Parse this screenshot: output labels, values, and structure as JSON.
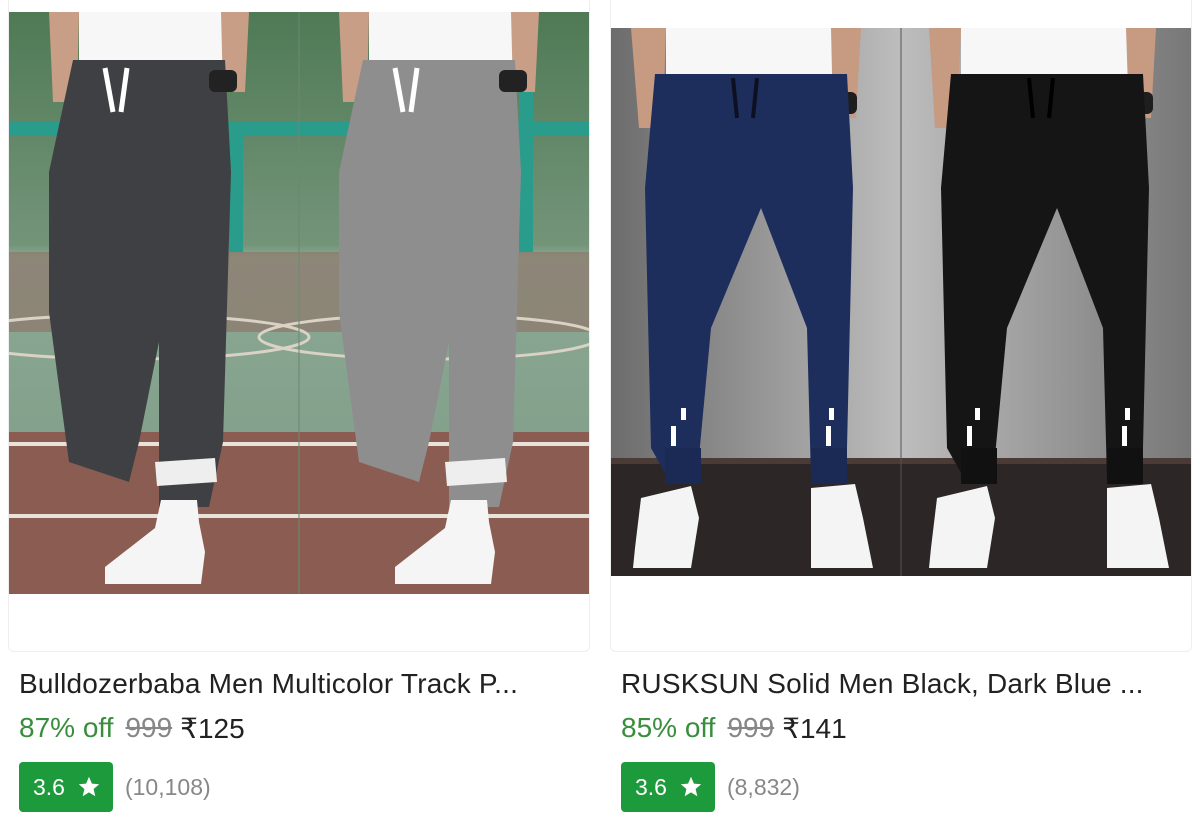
{
  "products": [
    {
      "title": "Bulldozerbaba Men Multicolor Track P...",
      "discount": "87% off",
      "mrp": "999",
      "price": "₹125",
      "rating": "3.6",
      "rating_count": "(10,108)",
      "image_alt": "Bulldozerbaba Men Multicolor Track Pants"
    },
    {
      "title": "RUSKSUN Solid Men Black, Dark Blue ...",
      "discount": "85% off",
      "mrp": "999",
      "price": "₹141",
      "rating": "3.6",
      "rating_count": "(8,832)",
      "image_alt": "RUSKSUN Solid Men Black, Dark Blue Track Pants"
    }
  ],
  "colors": {
    "discount_green": "#388e3c",
    "rating_badge_green": "#1d9a3b",
    "muted_grey": "#878787"
  },
  "icons": {
    "rating_star": "star-icon"
  }
}
